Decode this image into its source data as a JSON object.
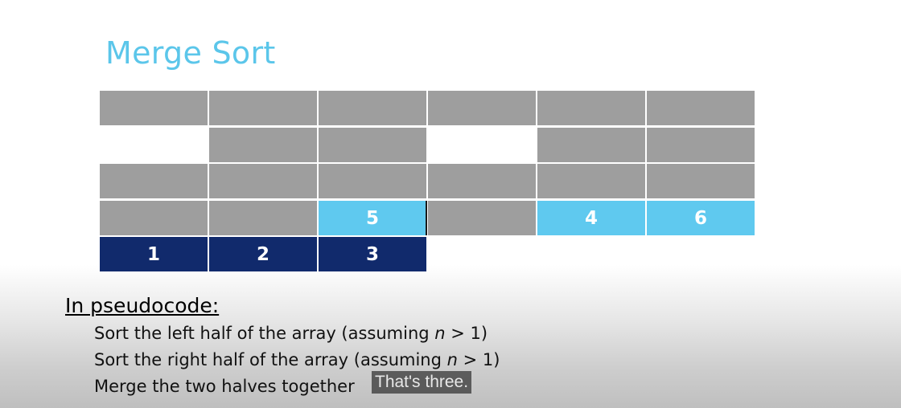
{
  "slide": {
    "title": "Merge Sort",
    "pseudocode_heading": "In pseudocode:",
    "lines": [
      {
        "before": "Sort the left half of the array (assuming ",
        "var": "n",
        "after": " > 1)"
      },
      {
        "before": "Sort the right half of the array (assuming ",
        "var": "n",
        "after": " > 1)"
      },
      {
        "before": "Merge the two halves together",
        "var": "",
        "after": ""
      }
    ]
  },
  "grid": {
    "row4_values": {
      "c2": "5",
      "c4": "4",
      "c5": "6"
    },
    "row5_values": {
      "c0": "1",
      "c1": "2",
      "c2": "3"
    }
  },
  "caption": {
    "text": "That's three."
  },
  "colors": {
    "title": "#5bc6ea",
    "gray_cell": "#9e9e9e",
    "light_cell": "#5fc9ef",
    "dark_cell": "#112a6c"
  }
}
